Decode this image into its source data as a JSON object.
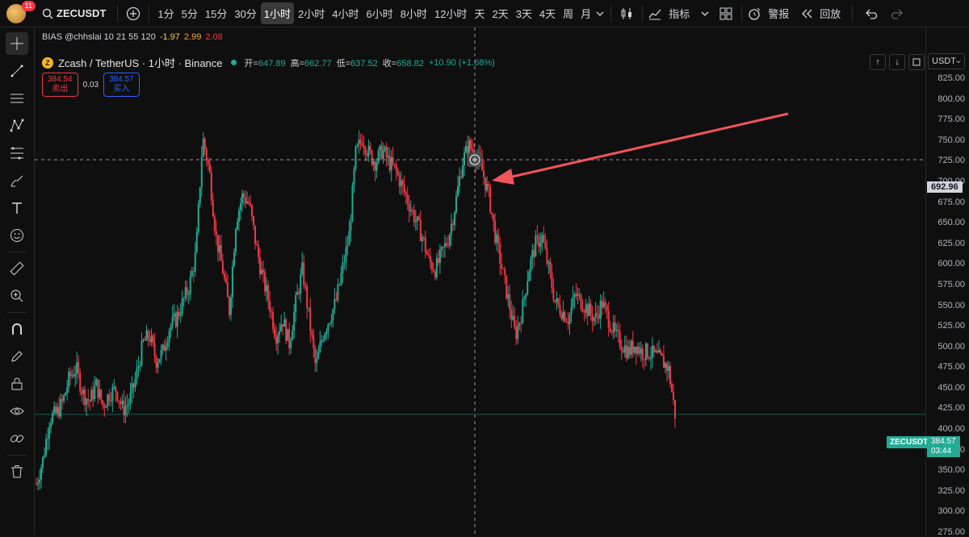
{
  "toolbar": {
    "notification_count": "11",
    "symbol": "ZECUSDT",
    "intervals": [
      "1分",
      "5分",
      "15分",
      "30分",
      "1小时",
      "2小时",
      "4小时",
      "6小时",
      "8小时",
      "12小时",
      "天",
      "2天",
      "3天",
      "4天",
      "周",
      "月"
    ],
    "active_interval": "1小时",
    "indicators_label": "指标",
    "alert_label": "警报",
    "replay_label": "回放"
  },
  "legend": {
    "bias_text": "BIAS @chhslai 10 21 55 120",
    "bias_values": [
      "-1.97",
      "2.99",
      "2.08"
    ],
    "bias_colors": [
      "#f5d142",
      "#f5a623",
      "#f23645"
    ],
    "title": "Zcash / TetherUS · 1小时 · Binance",
    "open_label": "开=",
    "open": "647.89",
    "high_label": "高=",
    "high": "662.77",
    "low_label": "低=",
    "low": "637.52",
    "close_label": "收=",
    "close": "658.82",
    "change": "+10.90 (+1.68%)",
    "sell_price": "384.54",
    "sell_label": "卖出",
    "spread": "0.03",
    "buy_price": "384.57",
    "buy_label": "买入"
  },
  "price_axis": {
    "currency": "USDT",
    "labels": [
      "825.00",
      "800.00",
      "775.00",
      "750.00",
      "725.00",
      "700.00",
      "675.00",
      "650.00",
      "625.00",
      "600.00",
      "575.00",
      "550.00",
      "525.00",
      "500.00",
      "475.00",
      "450.00",
      "425.00",
      "400.00",
      "375.00",
      "350.00",
      "325.00",
      "300.00",
      "275.00"
    ],
    "crosshair_price": "692.96",
    "ticker_tag": "ZECUSDT",
    "last_price": "384.57",
    "countdown": "03:44"
  },
  "colors": {
    "up": "#22ab94",
    "down": "#f23645",
    "arrow": "#f2545b",
    "background": "#0f0f0f"
  },
  "chart_data": {
    "type": "candlestick",
    "y_range": [
      275,
      825
    ],
    "crosshair_y": 692.96,
    "anchors": [
      300,
      330,
      380,
      385,
      400,
      430,
      440,
      410,
      400,
      420,
      395,
      410,
      415,
      390,
      400,
      430,
      470,
      480,
      450,
      460,
      490,
      500,
      520,
      540,
      580,
      720,
      680,
      600,
      560,
      510,
      620,
      650,
      640,
      590,
      550,
      520,
      480,
      500,
      470,
      520,
      560,
      500,
      440,
      480,
      500,
      520,
      560,
      600,
      700,
      720,
      700,
      690,
      705,
      690,
      680,
      660,
      640,
      620,
      600,
      570,
      560,
      580,
      600,
      640,
      690,
      710,
      700,
      680,
      650,
      600,
      560,
      520,
      480,
      510,
      560,
      590,
      600,
      560,
      520,
      510,
      500,
      530,
      520,
      510,
      500,
      520,
      500,
      480,
      470,
      460,
      470,
      460,
      460,
      455,
      450,
      440,
      385
    ]
  }
}
